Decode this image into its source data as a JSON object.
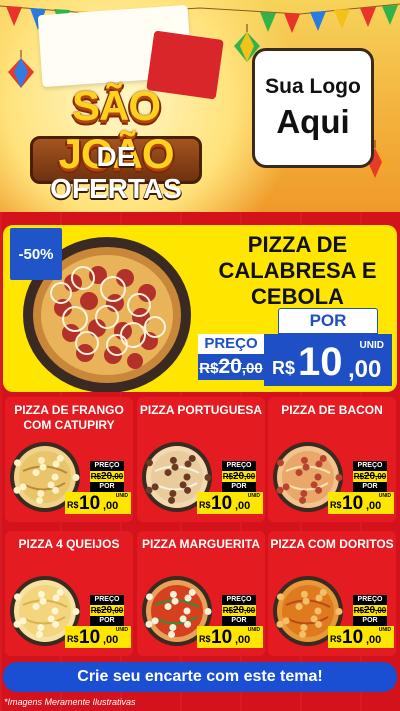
{
  "header": {
    "title_line1": "SÃO JOÃO",
    "title_line2": "DE OFERTAS",
    "logo_line1": "Sua Logo",
    "logo_line2": "Aqui"
  },
  "featured": {
    "discount": "-50%",
    "name": "PIZZA DE CALABRESA E CEBOLA",
    "por_label": "POR",
    "preco_label": "PREÇO",
    "old_currency": "R$",
    "old_int": "20",
    "old_dec": ",00",
    "currency": "R$",
    "new_int": "10",
    "new_dec": ",00",
    "unit": "UNID"
  },
  "products": [
    {
      "name": "PIZZA DE FRANGO COM CATUPIRY",
      "preco_label": "PREÇO",
      "old_currency": "R$",
      "old_int": "20",
      "old_dec": ",00",
      "por_label": "POR",
      "currency": "R$",
      "new_int": "10",
      "new_dec": ",00",
      "unit": "UNID"
    },
    {
      "name": "PIZZA PORTUGUESA",
      "preco_label": "PREÇO",
      "old_currency": "R$",
      "old_int": "20",
      "old_dec": ",00",
      "por_label": "POR",
      "currency": "R$",
      "new_int": "10",
      "new_dec": ",00",
      "unit": "UNID"
    },
    {
      "name": "PIZZA DE BACON",
      "preco_label": "PREÇO",
      "old_currency": "R$",
      "old_int": "20",
      "old_dec": ",00",
      "por_label": "POR",
      "currency": "R$",
      "new_int": "10",
      "new_dec": ",00",
      "unit": "UNID"
    },
    {
      "name": "PIZZA 4 QUEIJOS",
      "preco_label": "PREÇO",
      "old_currency": "R$",
      "old_int": "20",
      "old_dec": ",00",
      "por_label": "POR",
      "currency": "R$",
      "new_int": "10",
      "new_dec": ",00",
      "unit": "UNID"
    },
    {
      "name": "PIZZA MARGUERITA",
      "preco_label": "PREÇO",
      "old_currency": "R$",
      "old_int": "20",
      "old_dec": ",00",
      "por_label": "POR",
      "currency": "R$",
      "new_int": "10",
      "new_dec": ",00",
      "unit": "UNID"
    },
    {
      "name": "PIZZA COM DORITOS",
      "preco_label": "PREÇO",
      "old_currency": "R$",
      "old_int": "20",
      "old_dec": ",00",
      "por_label": "POR",
      "currency": "R$",
      "new_int": "10",
      "new_dec": ",00",
      "unit": "UNID"
    }
  ],
  "cta": {
    "label": "Crie seu encarte com este tema!"
  },
  "footnote": "*Imagens Meramente Ilustrativas",
  "colors": {
    "red": "#d4121c",
    "yellow": "#ffe600",
    "blue": "#1e4fc4"
  }
}
